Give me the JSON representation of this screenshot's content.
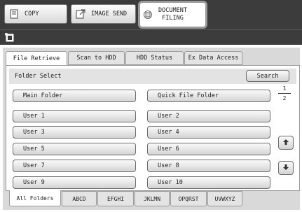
{
  "modes": [
    {
      "label": "COPY",
      "icon": "copy-icon"
    },
    {
      "label": "IMAGE SEND",
      "icon": "image-send-icon"
    },
    {
      "label_line1": "DOCUMENT",
      "label_line2": "FILING",
      "icon": "document-filing-icon"
    }
  ],
  "top_tabs": [
    "File Retrieve",
    "Scan to HDD",
    "HDD Status",
    "Ex Data Access"
  ],
  "folder_select": {
    "label": "Folder Select",
    "search_label": "Search"
  },
  "folders": {
    "main": "Main Folder",
    "quick": "Quick File Folder",
    "users": [
      "User 1",
      "User 2",
      "User 3",
      "User 4",
      "User 5",
      "User 6",
      "User 7",
      "User 8",
      "User 9",
      "User 10"
    ]
  },
  "pager": {
    "current": "1",
    "total": "2"
  },
  "bottom_tabs": [
    "All Folders",
    "ABCD",
    "EFGHI",
    "JKLMN",
    "OPQRST",
    "UVWXYZ"
  ]
}
